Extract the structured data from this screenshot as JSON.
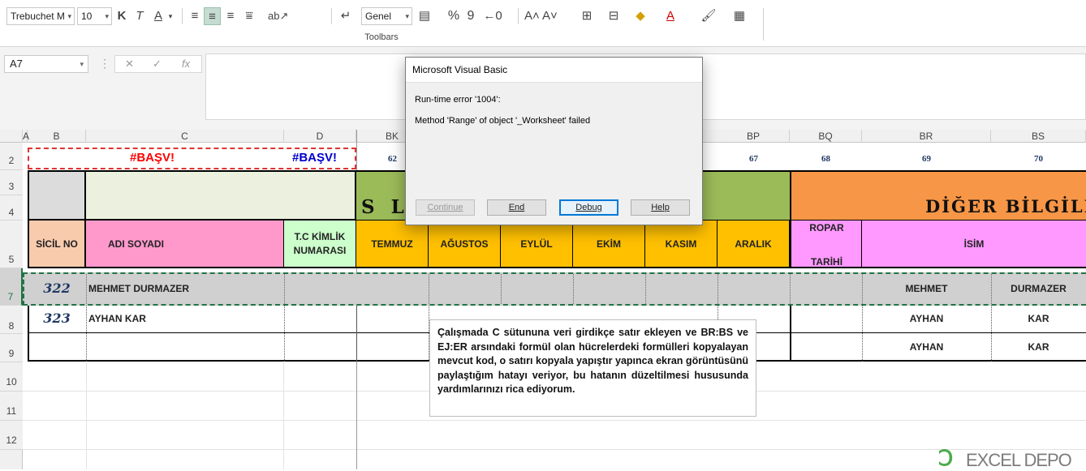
{
  "ribbon": {
    "font_name": "Trebuchet M",
    "font_size": "10",
    "bold": "K",
    "italic": "T",
    "underline": "A",
    "number_format": "Genel",
    "percent": "%",
    "thousands": "9",
    "toolbars_label": "Toolbars"
  },
  "formula_bar": {
    "name_box": "A7",
    "cancel": "✕",
    "confirm": "✓",
    "fx": "fx",
    "formula": ""
  },
  "columns": [
    "A",
    "B",
    "C",
    "D",
    "BK",
    "BP",
    "BQ",
    "BR",
    "BS"
  ],
  "rows": [
    "2",
    "3",
    "4",
    "5",
    "7",
    "8",
    "9",
    "10",
    "11",
    "12"
  ],
  "sheet": {
    "error_left": "#BAŞV!",
    "error_right": "#BAŞV!",
    "num_62": "62",
    "num_67": "67",
    "num_68": "68",
    "num_69": "69",
    "num_70": "70",
    "banner_left": "S L",
    "banner_right": "DİĞER BİLGİLE",
    "headers": {
      "sicil": "SİCİL NO",
      "adi": "ADI SOYADI",
      "tc": "T.C KİMLİK NUMARASI",
      "months": [
        "TEMMUZ",
        "AĞUSTOS",
        "EYLÜL",
        "EKİM",
        "KASIM",
        "ARALIK"
      ],
      "ropar_1": "ROPAR",
      "ropar_2": "TARİHİ",
      "isim": "İSİM"
    },
    "rows": [
      {
        "sicil": "322",
        "name": "MEHMET DURMAZER",
        "first": "MEHMET",
        "last": "DURMAZER"
      },
      {
        "sicil": "323",
        "name": "AYHAN KAR",
        "first": "AYHAN",
        "last": "KAR"
      },
      {
        "sicil": "",
        "name": "",
        "first": "AYHAN",
        "last": "KAR"
      }
    ]
  },
  "dialog": {
    "title": "Microsoft Visual Basic",
    "error_line": "Run-time error '1004':",
    "message": "Method 'Range' of object '_Worksheet' failed",
    "buttons": {
      "continue": "Continue",
      "end": "End",
      "debug": "Debug",
      "help": "Help"
    }
  },
  "note": "Çalışmada C sütununa veri girdikçe satır ekleyen ve BR:BS ve EJ:ER arsındaki formül olan hücrelerdeki formülleri kopyalayan mevcut kod,  o satırı kopyala yapıştır yapınca ekran görüntüsünü paylaştığım hatayı veriyor, bu hatanın düzeltilmesi hususunda yardımlarınızı rica ediyorum.",
  "watermark": "EXCEL DEPO",
  "colors": {
    "accent_green": "#217346",
    "header_peach": "#f8cbad",
    "header_pink": "#ff99cc",
    "header_mint": "#ccffcc",
    "header_gold": "#ffc000",
    "banner_olive": "#9bbb59",
    "banner_orange": "#f79646",
    "isim_violet": "#ff99ff",
    "error_red": "#ff0000",
    "error_blue": "#0000cc",
    "sicil_navy": "#1f3864"
  }
}
